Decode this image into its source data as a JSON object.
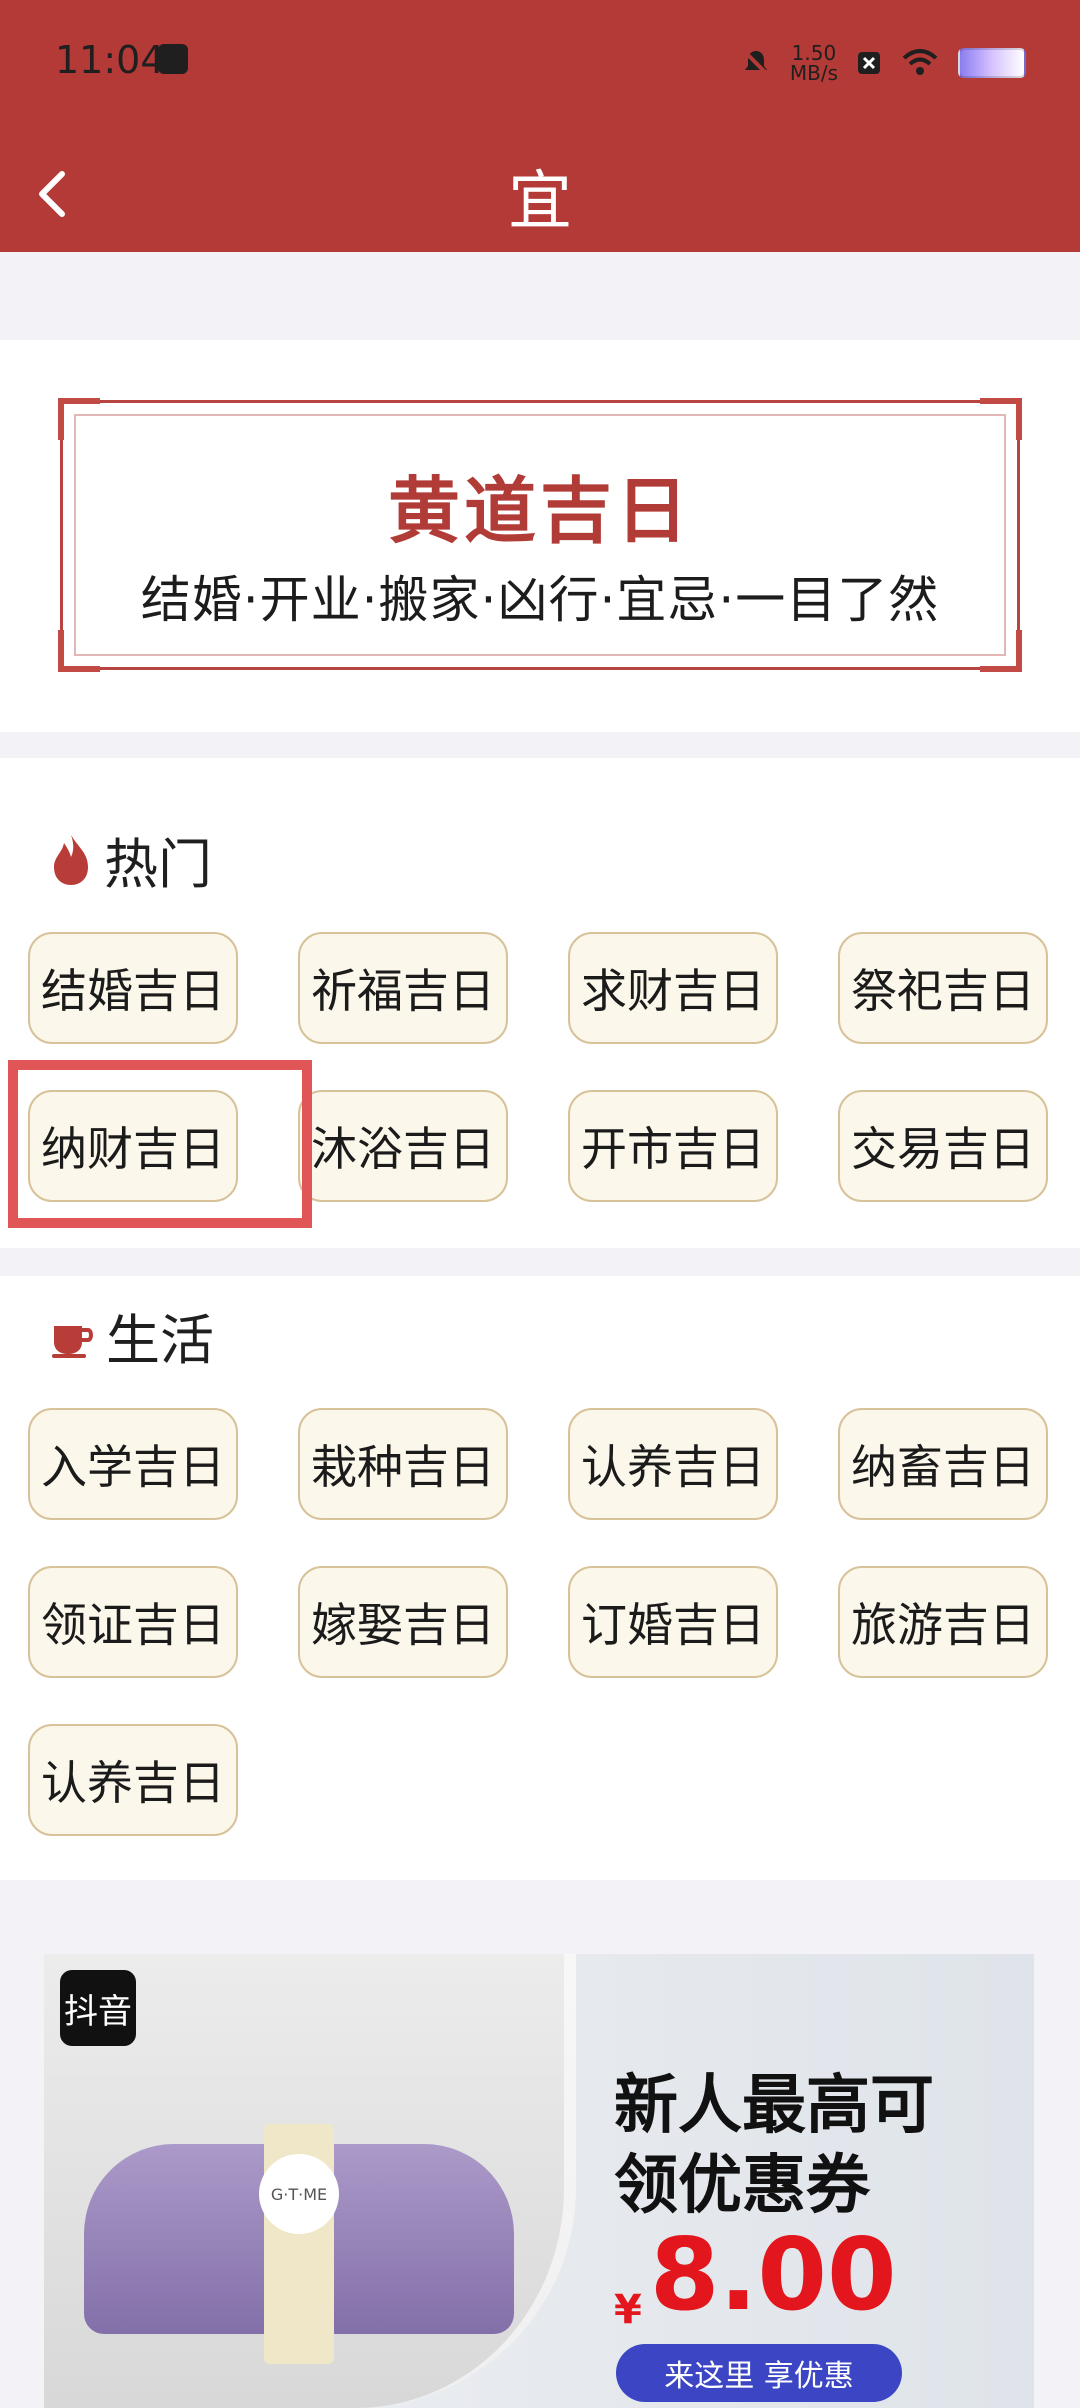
{
  "status_bar": {
    "time": "11:04",
    "speed_top": "1.50",
    "speed_bottom": "MB/s"
  },
  "header": {
    "title": "宜"
  },
  "banner": {
    "title": "黄道吉日",
    "subtitle": "结婚·开业·搬家·凶行·宜忌·一目了然"
  },
  "sections": {
    "hot": {
      "heading": "热门",
      "items": [
        "结婚吉日",
        "祈福吉日",
        "求财吉日",
        "祭祀吉日",
        "纳财吉日",
        "沐浴吉日",
        "开市吉日",
        "交易吉日"
      ]
    },
    "life": {
      "heading": "生活",
      "items": [
        "入学吉日",
        "栽种吉日",
        "认养吉日",
        "纳畜吉日",
        "领证吉日",
        "嫁娶吉日",
        "订婚吉日",
        "旅游吉日",
        "认养吉日"
      ]
    }
  },
  "ad": {
    "platform_label": "抖音",
    "line1": "新人最高可",
    "line2": "领优惠券",
    "currency": "¥",
    "price": "8.00",
    "cta": "来这里 享优惠",
    "brand_logo_text": "G·T·ME"
  },
  "colors": {
    "header": "#b33a36",
    "accent": "#b13b36",
    "highlight": "#e05555",
    "price": "#e3151d"
  }
}
